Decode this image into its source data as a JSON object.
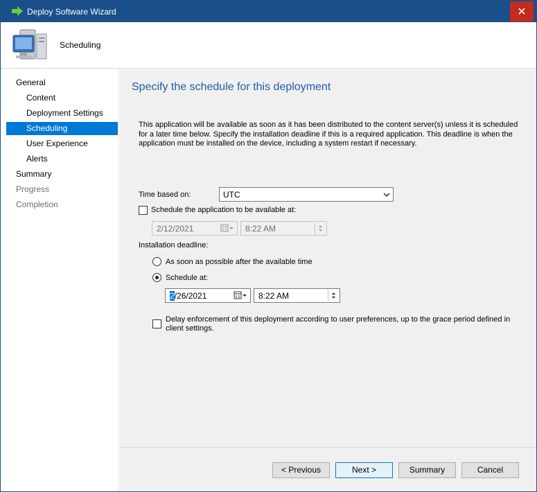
{
  "window": {
    "title": "Deploy Software Wizard",
    "close_glyph": "✕"
  },
  "header": {
    "step_title": "Scheduling"
  },
  "sidebar": {
    "items": [
      {
        "label": "General"
      },
      {
        "label": "Content"
      },
      {
        "label": "Deployment Settings"
      },
      {
        "label": "Scheduling"
      },
      {
        "label": "User Experience"
      },
      {
        "label": "Alerts"
      },
      {
        "label": "Summary"
      },
      {
        "label": "Progress"
      },
      {
        "label": "Completion"
      }
    ]
  },
  "content": {
    "heading": "Specify the schedule for this deployment",
    "description": "This application will be available as soon as it has been distributed to the content server(s) unless it is scheduled for a later time below. Specify the installation deadline if this is a required application. This deadline is when the application must be installed on the device, including a system restart if necessary.",
    "time_based_on": {
      "label": "Time based on:",
      "value": "UTC"
    },
    "available": {
      "label": "Schedule the application to be available at:",
      "checked": false,
      "date": "2/12/2021",
      "time": "8:22 AM"
    },
    "deadline": {
      "label": "Installation deadline:",
      "option_asap": "As soon as possible after the available time",
      "option_schedule": "Schedule at:",
      "selected": "schedule",
      "date_first_char": "2",
      "date_rest": "/26/2021",
      "time": "8:22 AM"
    },
    "delay": {
      "label": "Delay enforcement of this deployment according to user preferences, up to the grace period defined in client settings.",
      "checked": false
    }
  },
  "footer": {
    "previous": "< Previous",
    "next": "Next >",
    "summary": "Summary",
    "cancel": "Cancel"
  },
  "colors": {
    "titlebar": "#1a4f8a",
    "accent": "#0078d7",
    "close": "#c42b1c",
    "heading": "#1e5fa6"
  }
}
